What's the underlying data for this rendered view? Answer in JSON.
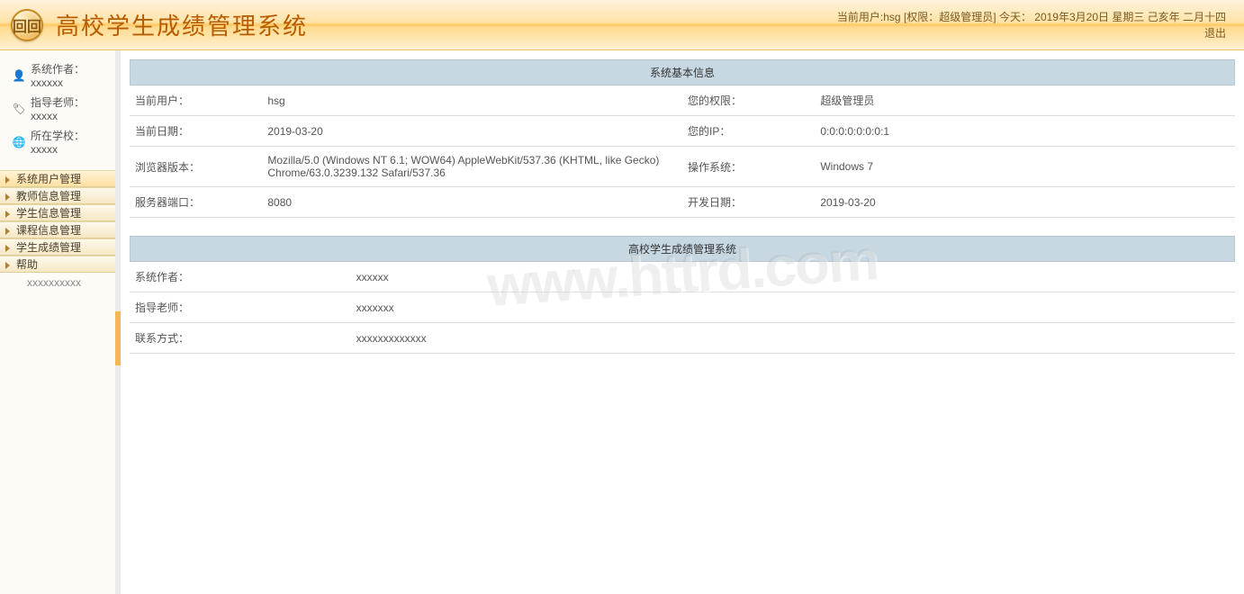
{
  "header": {
    "title": "高校学生成绩管理系统",
    "logo_text": "回回",
    "status_line": "当前用户:hsg [权限：超级管理员] 今天： 2019年3月20日 星期三 己亥年 二月十四",
    "logout": "退出"
  },
  "sidebar": {
    "info": [
      {
        "icon": "👤",
        "label": "系统作者：xxxxxx"
      },
      {
        "icon": "🏷",
        "label": "指导老师：xxxxx"
      },
      {
        "icon": "🌐",
        "label": "所在学校：xxxxx"
      }
    ],
    "menu": [
      {
        "label": "系统用户管理"
      },
      {
        "label": "教师信息管理"
      },
      {
        "label": "学生信息管理"
      },
      {
        "label": "课程信息管理"
      },
      {
        "label": "学生成绩管理"
      },
      {
        "label": "帮助",
        "sub": "xxxxxxxxxx"
      }
    ]
  },
  "panels": {
    "sysinfo": {
      "title": "系统基本信息",
      "rows": [
        [
          {
            "label": "当前用户：",
            "value": "hsg"
          },
          {
            "label": "您的权限：",
            "value": "超级管理员"
          }
        ],
        [
          {
            "label": "当前日期：",
            "value": "2019-03-20"
          },
          {
            "label": "您的IP：",
            "value": "0:0:0:0:0:0:0:1"
          }
        ],
        [
          {
            "label": "浏览器版本：",
            "value": "Mozilla/5.0 (Windows NT 6.1; WOW64) AppleWebKit/537.36 (KHTML, like Gecko) Chrome/63.0.3239.132 Safari/537.36"
          },
          {
            "label": "操作系统：",
            "value": "Windows 7"
          }
        ],
        [
          {
            "label": "服务器端口：",
            "value": "8080"
          },
          {
            "label": "开发日期：",
            "value": "2019-03-20"
          }
        ]
      ]
    },
    "about": {
      "title": "高校学生成绩管理系统",
      "rows": [
        {
          "label": "系统作者：",
          "value": "xxxxxx"
        },
        {
          "label": "指导老师：",
          "value": "xxxxxxx"
        },
        {
          "label": "联系方式：",
          "value": "xxxxxxxxxxxxx"
        }
      ]
    }
  },
  "watermark": "www.httrd.com"
}
